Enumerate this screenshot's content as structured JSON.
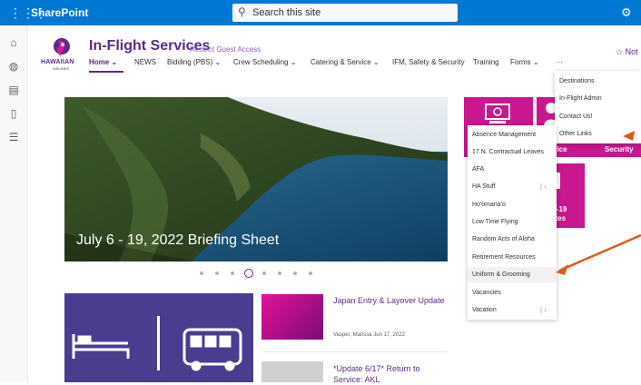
{
  "suite_bar": {
    "app_name": "SharePoint",
    "search_placeholder": "Search this site",
    "icons": [
      "waffle-icon",
      "search-icon",
      "settings-icon"
    ]
  },
  "site": {
    "logo_text": "HAWAIIAN",
    "logo_subtext": "AIRLINES",
    "title": "In-Flight Services",
    "guest_access": "Restrict Guest Access",
    "follow": "☆ Not",
    "nav": [
      "Home ⌄",
      "NEWS",
      "Bidding (PBS) ⌄",
      "Crew Scheduling ⌄",
      "Catering & Service ⌄",
      "IFM, Safety & Security",
      "Training",
      "Forms ⌄",
      "···"
    ]
  },
  "hero": {
    "title": "July 6 - 19, 2022 Briefing Sheet",
    "dots_count": 8,
    "active_dot": 4
  },
  "news": [
    {
      "title": "Japan Entry & Layover Update",
      "author": "Vasper, Marissa",
      "date": "Jun 17, 2022"
    },
    {
      "title": "*Update 6/17* Return to Service: AKL"
    }
  ],
  "tiles": {
    "left_label": "vice",
    "right_label": "Security",
    "lower_label_1": "D-19",
    "lower_label_2": "ates"
  },
  "more_menu": {
    "items": [
      "Destinations",
      "In-Flight Admin",
      "Contact Us!",
      "Other Links"
    ]
  },
  "other_links_menu": {
    "items": [
      "Absence Management",
      "17.N. Contractual Leaves",
      "AFA",
      "HA Stuff",
      "Ho'omana'o",
      "Low Time Flying",
      "Random Acts of Aloha",
      "Retirement Resources",
      "Uniform & Grooming",
      "Vacancies",
      "Vacation"
    ],
    "highlighted": "Uniform & Grooming"
  },
  "colors": {
    "suite_bar": "#0078d4",
    "brand_purple": "#5b2b85",
    "tile_magenta": "#c8178f",
    "annotation_arrow": "#e05a1e"
  }
}
